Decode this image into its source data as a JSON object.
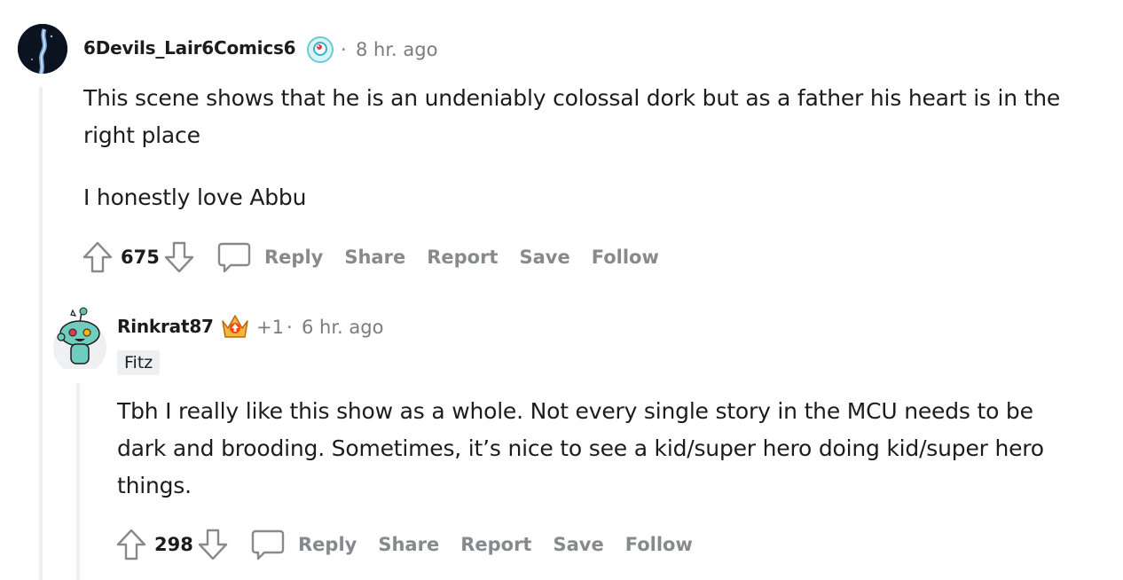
{
  "comments": [
    {
      "author": "6Devils_Lair6Comics6",
      "time": "8 hr. ago",
      "paragraphs": [
        "This scene shows that he is an undeniably colossal dork but as a father his heart is in the right place",
        "I honestly love Abbu"
      ],
      "score": "675",
      "actions": {
        "reply": "Reply",
        "share": "Share",
        "report": "Report",
        "save": "Save",
        "follow": "Follow"
      }
    },
    {
      "author": "Rinkrat87",
      "award_count": "+1",
      "time": "6 hr. ago",
      "flair": "Fitz",
      "paragraphs": [
        "Tbh I really like this show as a whole. Not every single story in the MCU needs to be dark and brooding. Sometimes, it’s nice to see a kid/super hero doing kid/super hero things."
      ],
      "score": "298",
      "actions": {
        "reply": "Reply",
        "share": "Share",
        "report": "Report",
        "save": "Save",
        "follow": "Follow"
      }
    }
  ],
  "meta_separator": "·",
  "colors": {
    "accent": "#878a8c",
    "thread_line": "#edeff1",
    "flair_bg": "#edeff1"
  }
}
